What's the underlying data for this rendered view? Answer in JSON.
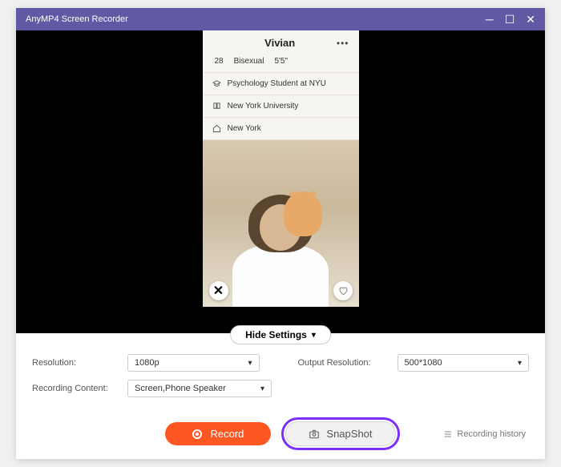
{
  "titlebar": {
    "title": "AnyMP4 Screen Recorder"
  },
  "profile": {
    "name": "Vivian",
    "age": "28",
    "orientation": "Bisexual",
    "height": "5'5\"",
    "info": {
      "education": "Psychology Student at NYU",
      "school": "New York University",
      "city": "New York"
    }
  },
  "controls": {
    "hide_settings": "Hide Settings"
  },
  "settings": {
    "resolution_label": "Resolution:",
    "resolution_value": "1080p",
    "output_label": "Output Resolution:",
    "output_value": "500*1080",
    "content_label": "Recording Content:",
    "content_value": "Screen,Phone Speaker"
  },
  "buttons": {
    "record": "Record",
    "snapshot": "SnapShot",
    "history": "Recording history"
  },
  "colors": {
    "titlebar": "#6159a3",
    "record": "#ff5722",
    "highlight": "#7b2ff7"
  }
}
